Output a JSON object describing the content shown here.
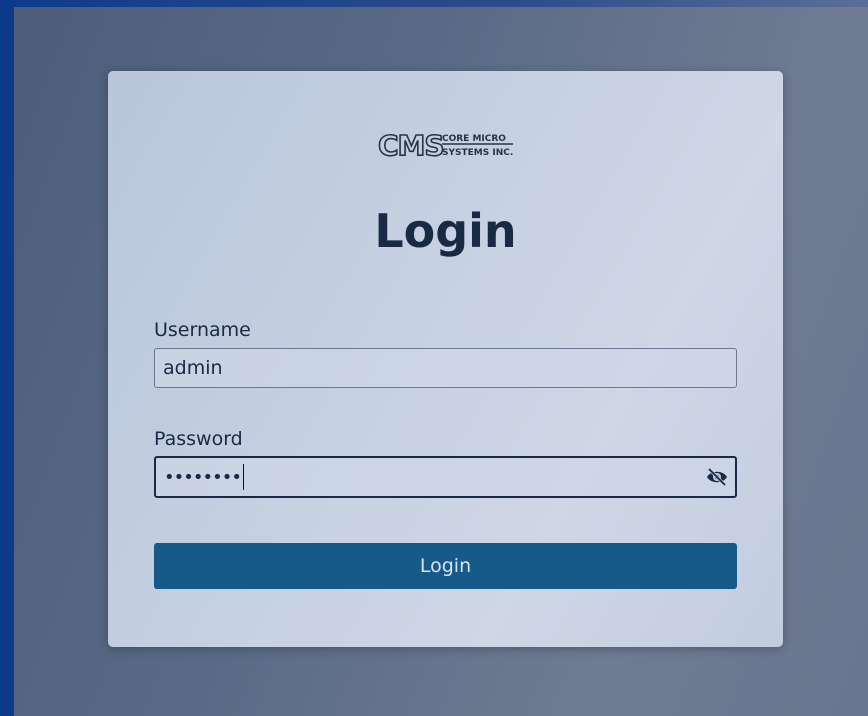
{
  "logo": {
    "mark": "CMS",
    "line1": "CORE MICRO",
    "line2": "SYSTEMS INC."
  },
  "form": {
    "title": "Login",
    "username_label": "Username",
    "username_value": "admin",
    "password_label": "Password",
    "password_masked": "••••••••",
    "submit_label": "Login"
  },
  "colors": {
    "accent": "#165a8a",
    "title_text": "#1b2a44"
  },
  "icons": {
    "password_toggle": "eye-slash-icon"
  }
}
